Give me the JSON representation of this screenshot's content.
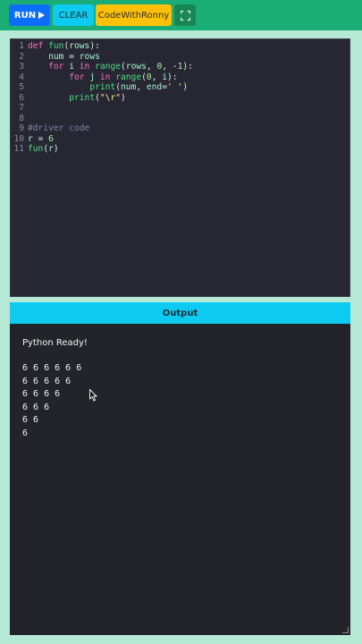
{
  "toolbar": {
    "run_label": "RUN",
    "run_icon": "play-icon",
    "clear_label": "CLEAR",
    "brand_label": "CodeWithRonny",
    "expand_icon": "fullscreen-icon"
  },
  "editor": {
    "line_numbers": [
      "1",
      "2",
      "3",
      "4",
      "5",
      "6",
      "7",
      "8",
      "9",
      "10",
      "11"
    ],
    "lines": [
      "def fun(rows):",
      "    num = rows",
      "    for i in range(rows, 0, -1):",
      "        for j in range(0, i):",
      "            print(num, end=' ')",
      "        print(\"\\r\")",
      "",
      "",
      "#driver code",
      "r = 6",
      "fun(r)"
    ]
  },
  "output": {
    "title": "Output",
    "ready_message": "Python Ready!",
    "lines": [
      "6 6 6 6 6 6",
      "6 6 6 6 6",
      "6 6 6 6",
      "6 6 6",
      "6 6",
      "6"
    ]
  },
  "colors": {
    "toolbar": "#1aad75",
    "run": "#0d6efd",
    "clear": "#0dcaf0",
    "brand": "#ffc107",
    "expand": "#198754",
    "editor_bg": "#272733",
    "output_bg": "#212529"
  }
}
